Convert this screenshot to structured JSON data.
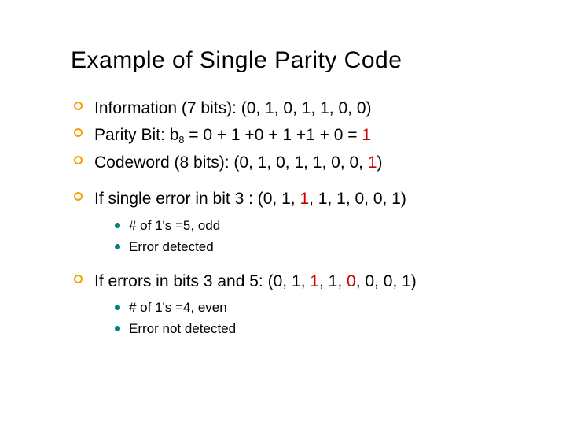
{
  "title": "Example of Single Parity Code",
  "bullets": {
    "info_label": "Information (7 bits):  (0, 1, 0, 1, 1, 0, 0)",
    "parity_prefix": "Parity Bit: b",
    "parity_sub": "8",
    "parity_rest": " = 0 + 1 +0 + 1 +1 + 0 = ",
    "parity_result": "1",
    "codeword_prefix": "Codeword (8 bits): (0, 1, 0, 1, 1, 0, 0, ",
    "codeword_red": "1",
    "codeword_suffix": ")",
    "single_err_prefix": "If single error in bit 3 : (0, 1, ",
    "single_err_red": "1",
    "single_err_suffix": ", 1, 1, 0, 0, 1)",
    "single_sub1": "# of 1's =5, odd",
    "single_sub2": "Error detected",
    "double_err_prefix": "If errors in bits 3 and 5: (0, 1, ",
    "double_err_red1": "1",
    "double_err_mid": ", 1, ",
    "double_err_red2": "0",
    "double_err_suffix": ", 0, 0, 1)",
    "double_sub1": "# of 1's =4, even",
    "double_sub2": "Error not detected"
  }
}
